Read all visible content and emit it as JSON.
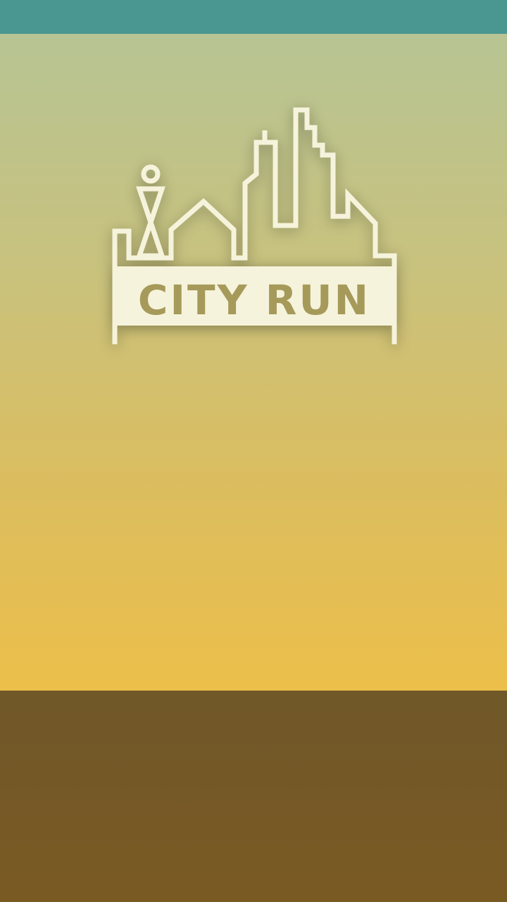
{
  "game": {
    "title": "CITY RUN"
  },
  "colors": {
    "status_bar": "#4a9690",
    "sky_top": "#b7c493",
    "sky_bottom": "#ecbf4a",
    "ground": "#74582a",
    "logo_line": "#f6f3dc",
    "logo_text": "#a69a5a"
  },
  "icons": {
    "logo": "city-skyline-with-runner-icon"
  }
}
